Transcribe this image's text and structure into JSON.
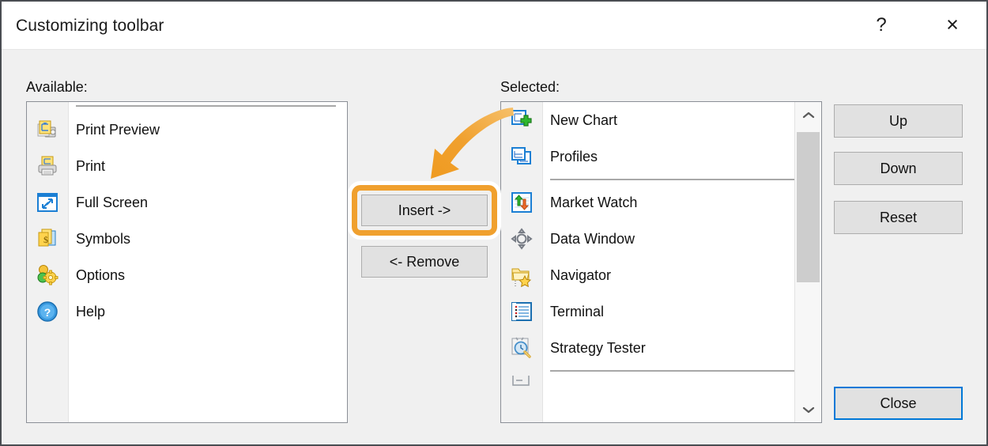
{
  "window": {
    "title": "Customizing toolbar",
    "help_button": "?",
    "close_button": "×"
  },
  "colors": {
    "accent_highlight": "#f0a02e",
    "focus_border": "#0078d7",
    "dialog_background": "#f0f0f0",
    "titlebar_background": "#ffffff",
    "list_background": "#ffffff",
    "button_face": "#e1e1e1"
  },
  "available": {
    "label": "Available:",
    "items": [
      {
        "label": "Print Preview",
        "icon": "print-preview-icon"
      },
      {
        "label": "Print",
        "icon": "print-icon"
      },
      {
        "label": "Full Screen",
        "icon": "full-screen-icon"
      },
      {
        "label": "Symbols",
        "icon": "symbols-icon"
      },
      {
        "label": "Options",
        "icon": "options-icon"
      },
      {
        "label": "Help",
        "icon": "help-icon"
      }
    ]
  },
  "selected": {
    "label": "Selected:",
    "items": [
      {
        "label": "New Chart",
        "icon": "new-chart-icon"
      },
      {
        "label": "Profiles",
        "icon": "profiles-icon"
      },
      {
        "label": "Market Watch",
        "icon": "market-watch-icon"
      },
      {
        "label": "Data Window",
        "icon": "data-window-icon"
      },
      {
        "label": "Navigator",
        "icon": "navigator-icon"
      },
      {
        "label": "Terminal",
        "icon": "terminal-icon"
      },
      {
        "label": "Strategy Tester",
        "icon": "strategy-tester-icon"
      }
    ],
    "scrollbar": {
      "up_arrow": "˄",
      "down_arrow": "˅"
    }
  },
  "middle_buttons": {
    "insert": "Insert ->",
    "remove": "<- Remove"
  },
  "side_buttons": {
    "up": "Up",
    "down": "Down",
    "reset": "Reset",
    "close": "Close"
  }
}
